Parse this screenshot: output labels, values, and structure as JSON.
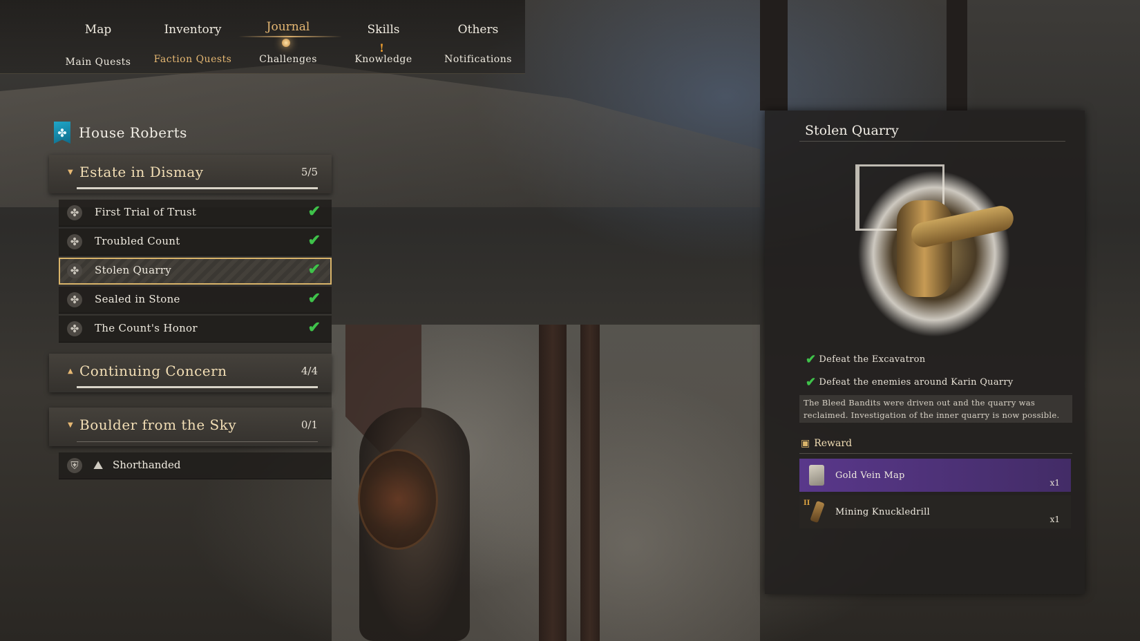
{
  "nav": {
    "tabs": [
      "Map",
      "Inventory",
      "Journal",
      "Skills",
      "Others"
    ],
    "active_tab": "Journal",
    "subtabs": [
      "Main Quests",
      "Faction Quests",
      "Challenges",
      "Knowledge",
      "Notifications"
    ],
    "active_subtab": "Faction Quests",
    "knowledge_alert": "!"
  },
  "faction": {
    "name": "House Roberts",
    "groups": [
      {
        "title": "Estate in Dismay",
        "count": "5/5",
        "expanded": true,
        "quests": [
          {
            "name": "First Trial of Trust",
            "completed": true
          },
          {
            "name": "Troubled Count",
            "completed": true
          },
          {
            "name": "Stolen Quarry",
            "completed": true,
            "selected": true
          },
          {
            "name": "Sealed in Stone",
            "completed": true
          },
          {
            "name": "The Count's Honor",
            "completed": true
          }
        ]
      },
      {
        "title": "Continuing Concern",
        "count": "4/4",
        "expanded": false,
        "quests": []
      },
      {
        "title": "Boulder from the Sky",
        "count": "0/1",
        "expanded": true,
        "quests": [
          {
            "name": "Shorthanded",
            "completed": false
          }
        ]
      }
    ]
  },
  "detail": {
    "title": "Stolen Quarry",
    "objectives": [
      {
        "text": "Defeat the Excavatron",
        "completed": true
      },
      {
        "text": "Defeat the enemies around Karin Quarry",
        "completed": true
      }
    ],
    "description": "The Bleed Bandits were driven out and the quarry was reclaimed. Investigation of the inner quarry is now possible.",
    "reward_label": "Reward",
    "rewards": [
      {
        "name": "Gold Vein Map",
        "qty": "x1",
        "rarity": "purple",
        "icon": "map-scroll-icon"
      },
      {
        "name": "Mining Knuckledrill",
        "qty": "x1",
        "rarity": "common",
        "tier": "II",
        "icon": "knuckledrill-icon"
      }
    ]
  },
  "colors": {
    "accent_gold": "#e6b873",
    "check_green": "#3fc24a",
    "reward_purple": "#5f3a96",
    "faction_blue": "#1fa7c9"
  }
}
